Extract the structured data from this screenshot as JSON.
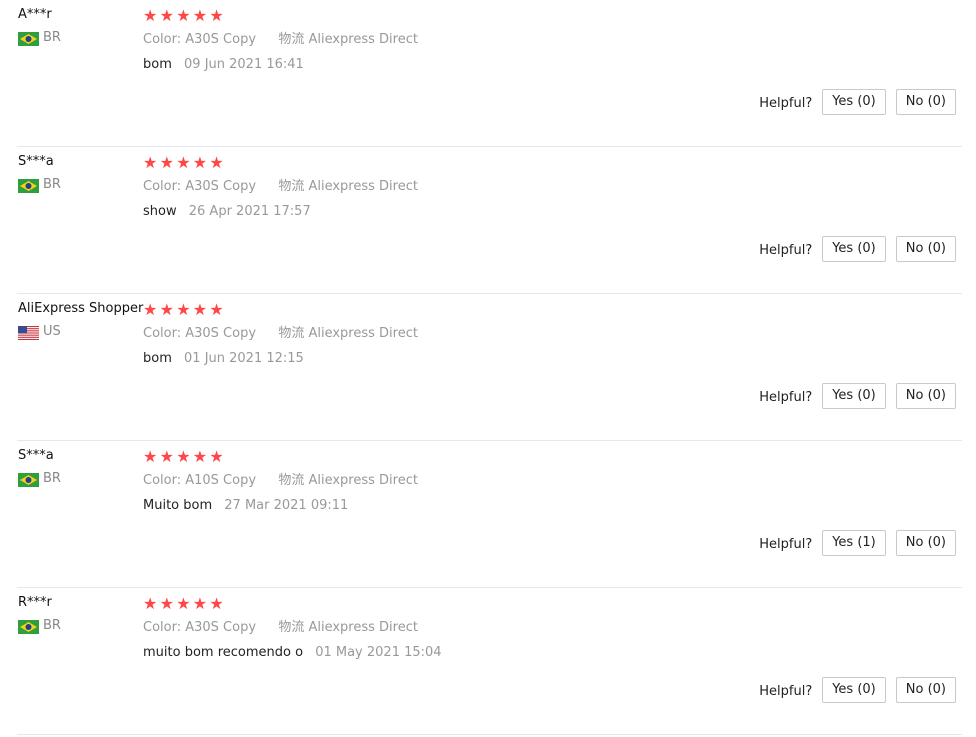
{
  "labels": {
    "color": "Color:",
    "logistics": "物流",
    "helpful": "Helpful?"
  },
  "colors": {
    "star": "#ff4747"
  },
  "reviews": [
    {
      "user": "A***r",
      "country": "BR",
      "flag": "brazil-flag-icon",
      "rating": 5,
      "color_value": "A30S Copy",
      "logistics_value": "Aliexpress Direct",
      "text": "bom",
      "date": "09 Jun 2021 16:41",
      "yes": "Yes (0)",
      "no": "No (0)"
    },
    {
      "user": "S***a",
      "country": "BR",
      "flag": "brazil-flag-icon",
      "rating": 5,
      "color_value": "A30S Copy",
      "logistics_value": "Aliexpress Direct",
      "text": "show",
      "date": "26 Apr 2021 17:57",
      "yes": "Yes (0)",
      "no": "No (0)"
    },
    {
      "user": "AliExpress Shopper",
      "country": "US",
      "flag": "us-flag-icon",
      "rating": 5,
      "color_value": "A30S Copy",
      "logistics_value": "Aliexpress Direct",
      "text": "bom",
      "date": "01 Jun 2021 12:15",
      "yes": "Yes (0)",
      "no": "No (0)"
    },
    {
      "user": "S***a",
      "country": "BR",
      "flag": "brazil-flag-icon",
      "rating": 5,
      "color_value": "A10S Copy",
      "logistics_value": "Aliexpress Direct",
      "text": "Muito bom",
      "date": "27 Mar 2021 09:11",
      "yes": "Yes (1)",
      "no": "No (0)"
    },
    {
      "user": "R***r",
      "country": "BR",
      "flag": "brazil-flag-icon",
      "rating": 5,
      "color_value": "A30S Copy",
      "logistics_value": "Aliexpress Direct",
      "text": "muito bom recomendo o",
      "date": "01 May 2021 15:04",
      "yes": "Yes (0)",
      "no": "No (0)"
    }
  ]
}
